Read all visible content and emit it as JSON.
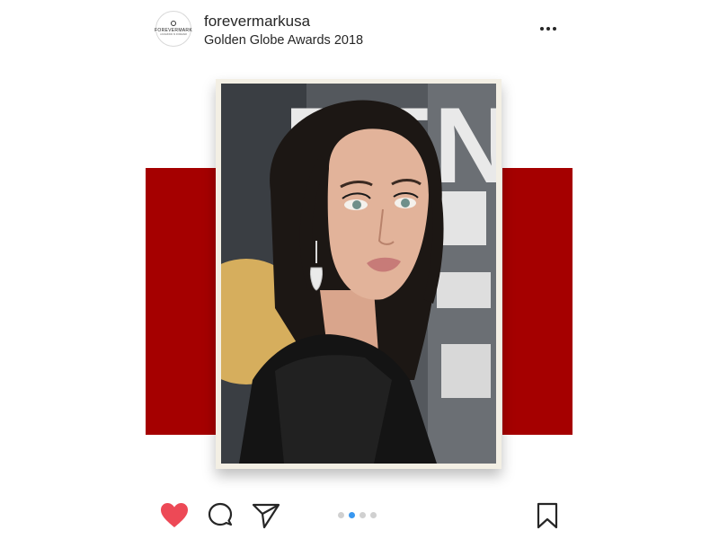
{
  "post": {
    "username": "forevermarkusa",
    "location": "Golden Globe Awards 2018",
    "avatar": {
      "brand": "FOREVERMARK",
      "tagline": "A DIAMOND IS FOREVER"
    },
    "photo_background_letters": "DEN",
    "colors": {
      "accent_red": "#a50000",
      "like_red": "#ed4956",
      "active_dot": "#3897f0"
    }
  },
  "header": {
    "more_icon": "more-horizontal-icon"
  },
  "actions": {
    "like_icon": "heart-filled-icon",
    "comment_icon": "comment-icon",
    "share_icon": "paper-plane-icon",
    "save_icon": "bookmark-icon",
    "liked": true
  },
  "carousel": {
    "total": 4,
    "active_index": 1
  }
}
